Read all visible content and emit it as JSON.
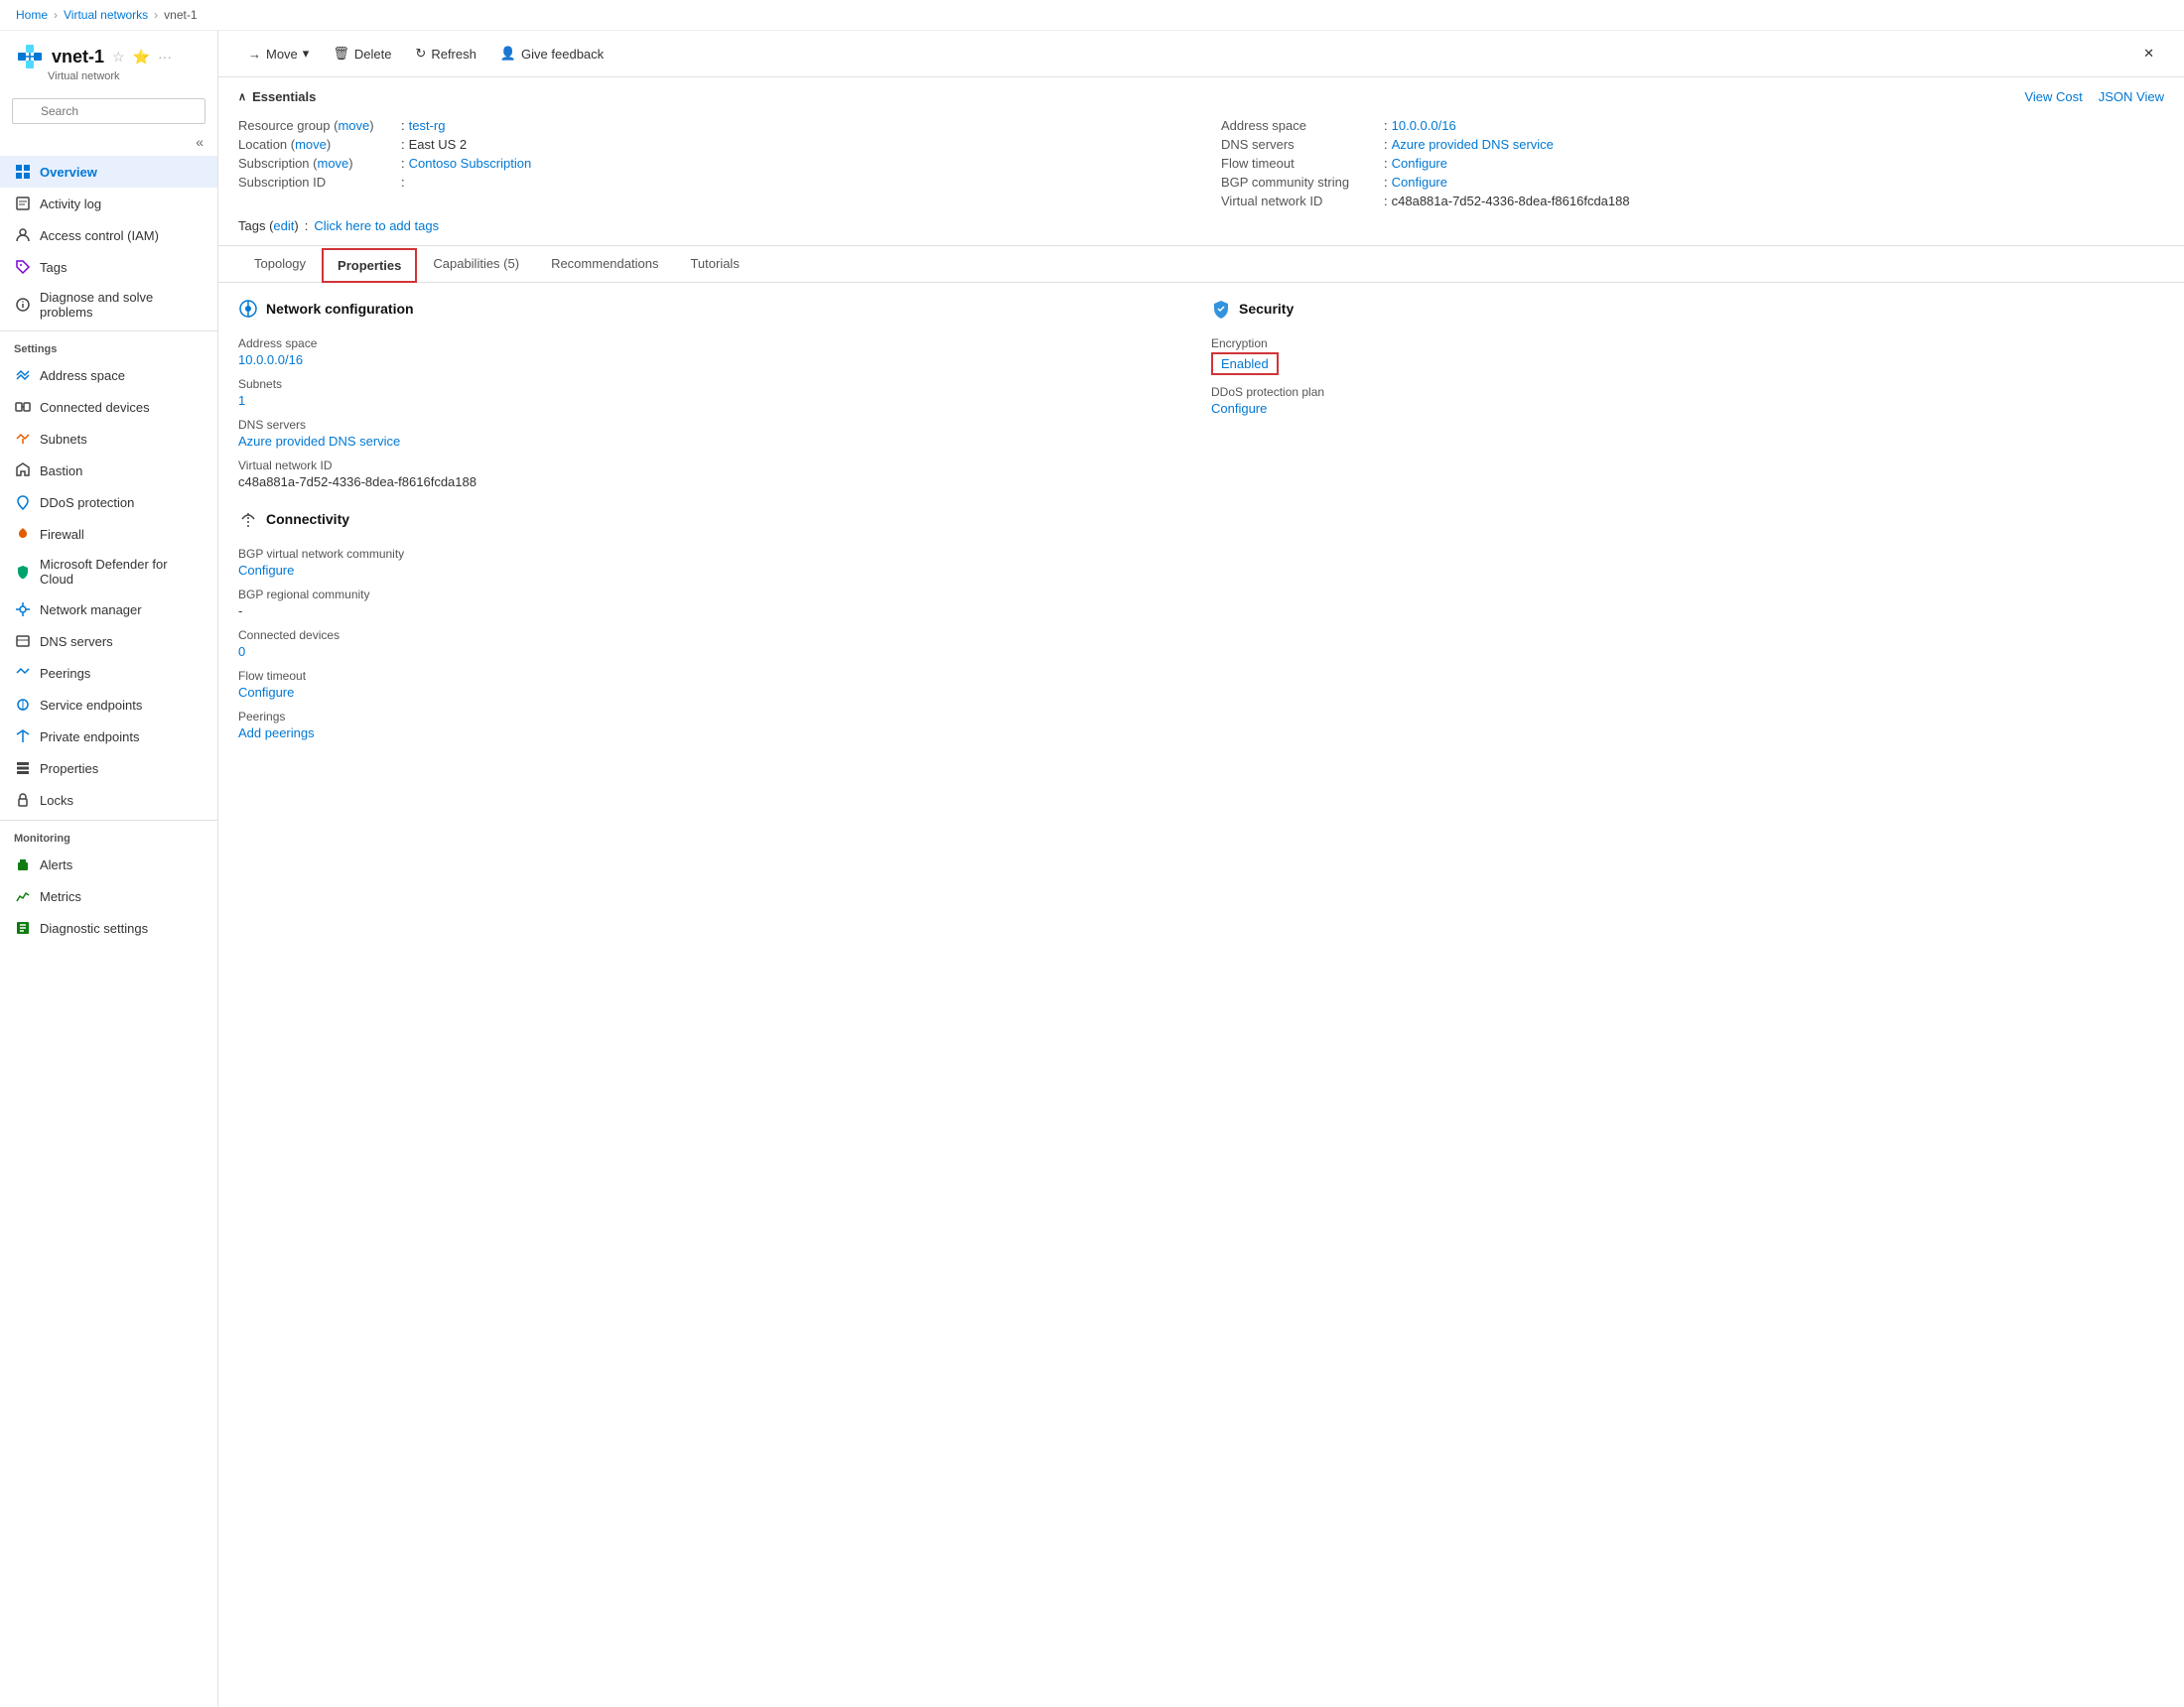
{
  "breadcrumb": {
    "home": "Home",
    "virtualNetworks": "Virtual networks",
    "current": "vnet-1"
  },
  "sidebar": {
    "title": "vnet-1",
    "subtitle": "Virtual network",
    "search_placeholder": "Search",
    "collapse_icon": "«",
    "nav_items": [
      {
        "id": "overview",
        "label": "Overview",
        "active": true,
        "icon": "overview"
      },
      {
        "id": "activity-log",
        "label": "Activity log",
        "active": false,
        "icon": "activity"
      },
      {
        "id": "access-control",
        "label": "Access control (IAM)",
        "active": false,
        "icon": "iam"
      },
      {
        "id": "tags",
        "label": "Tags",
        "active": false,
        "icon": "tags"
      },
      {
        "id": "diagnose",
        "label": "Diagnose and solve problems",
        "active": false,
        "icon": "diagnose"
      }
    ],
    "settings_label": "Settings",
    "settings_items": [
      {
        "id": "address-space",
        "label": "Address space",
        "icon": "address"
      },
      {
        "id": "connected-devices",
        "label": "Connected devices",
        "icon": "devices"
      },
      {
        "id": "subnets",
        "label": "Subnets",
        "icon": "subnets"
      },
      {
        "id": "bastion",
        "label": "Bastion",
        "icon": "bastion"
      },
      {
        "id": "ddos-protection",
        "label": "DDoS protection",
        "icon": "ddos"
      },
      {
        "id": "firewall",
        "label": "Firewall",
        "icon": "firewall"
      },
      {
        "id": "ms-defender",
        "label": "Microsoft Defender for Cloud",
        "icon": "defender"
      },
      {
        "id": "network-manager",
        "label": "Network manager",
        "icon": "network-mgr"
      },
      {
        "id": "dns-servers",
        "label": "DNS servers",
        "icon": "dns"
      },
      {
        "id": "peerings",
        "label": "Peerings",
        "icon": "peerings"
      },
      {
        "id": "service-endpoints",
        "label": "Service endpoints",
        "icon": "service-ep"
      },
      {
        "id": "private-endpoints",
        "label": "Private endpoints",
        "icon": "private-ep"
      },
      {
        "id": "properties",
        "label": "Properties",
        "icon": "properties"
      },
      {
        "id": "locks",
        "label": "Locks",
        "icon": "locks"
      }
    ],
    "monitoring_label": "Monitoring",
    "monitoring_items": [
      {
        "id": "alerts",
        "label": "Alerts",
        "icon": "alerts"
      },
      {
        "id": "metrics",
        "label": "Metrics",
        "icon": "metrics"
      },
      {
        "id": "diagnostic-settings",
        "label": "Diagnostic settings",
        "icon": "diag-settings"
      }
    ]
  },
  "toolbar": {
    "move_label": "Move",
    "delete_label": "Delete",
    "refresh_label": "Refresh",
    "feedback_label": "Give feedback",
    "close_label": "✕"
  },
  "essentials": {
    "title": "Essentials",
    "view_cost": "View Cost",
    "json_view": "JSON View",
    "left_fields": [
      {
        "label": "Resource group",
        "value": "test-rg",
        "value_link": true,
        "prefix": "(move)",
        "colon": ":"
      },
      {
        "label": "Location",
        "value": "East US 2",
        "move_link": "(move)",
        "colon": ":"
      },
      {
        "label": "Subscription",
        "value": "Contoso Subscription",
        "value_link": true,
        "move_link": "(move)",
        "colon": ":"
      },
      {
        "label": "Subscription ID",
        "value": "",
        "colon": ":"
      }
    ],
    "right_fields": [
      {
        "label": "Address space",
        "value": "10.0.0.0/16",
        "value_link": true,
        "colon": ":"
      },
      {
        "label": "DNS servers",
        "value": "Azure provided DNS service",
        "value_link": true,
        "colon": ":"
      },
      {
        "label": "Flow timeout",
        "value": "Configure",
        "value_link": true,
        "colon": ":"
      },
      {
        "label": "BGP community string",
        "value": "Configure",
        "value_link": true,
        "colon": ":"
      },
      {
        "label": "Virtual network ID",
        "value": "c48a881a-7d52-4336-8dea-f8616fcda188",
        "colon": ":"
      }
    ],
    "tags_label": "Tags",
    "tags_edit": "edit",
    "tags_value": "Click here to add tags"
  },
  "tabs": [
    {
      "id": "topology",
      "label": "Topology",
      "active": false,
      "highlighted": false
    },
    {
      "id": "properties",
      "label": "Properties",
      "active": true,
      "highlighted": true
    },
    {
      "id": "capabilities",
      "label": "Capabilities (5)",
      "active": false,
      "highlighted": false
    },
    {
      "id": "recommendations",
      "label": "Recommendations",
      "active": false,
      "highlighted": false
    },
    {
      "id": "tutorials",
      "label": "Tutorials",
      "active": false,
      "highlighted": false
    }
  ],
  "properties": {
    "network_config": {
      "title": "Network configuration",
      "items": [
        {
          "id": "address-space",
          "label": "Address space",
          "value": "10.0.0.0/16",
          "is_link": true
        },
        {
          "id": "subnets",
          "label": "Subnets",
          "value": "1",
          "is_link": true
        },
        {
          "id": "dns-servers",
          "label": "DNS servers",
          "value": "Azure provided DNS service",
          "is_link": true
        },
        {
          "id": "vnet-id",
          "label": "Virtual network ID",
          "value": "c48a881a-7d52-4336-8dea-f8616fcda188",
          "is_link": false
        }
      ]
    },
    "connectivity": {
      "title": "Connectivity",
      "items": [
        {
          "id": "bgp-community",
          "label": "BGP virtual network community",
          "value": "Configure",
          "is_link": true
        },
        {
          "id": "bgp-regional",
          "label": "BGP regional community",
          "value": "-",
          "is_link": false
        },
        {
          "id": "connected-devices",
          "label": "Connected devices",
          "value": "0",
          "is_link": true
        },
        {
          "id": "flow-timeout",
          "label": "Flow timeout",
          "value": "Configure",
          "is_link": true
        },
        {
          "id": "peerings",
          "label": "Peerings",
          "value": "Add peerings",
          "is_link": true
        }
      ]
    },
    "security": {
      "title": "Security",
      "encryption_label": "Encryption",
      "encryption_value": "Enabled",
      "ddos_label": "DDoS protection plan",
      "ddos_value": "Configure",
      "ddos_link": true
    }
  }
}
